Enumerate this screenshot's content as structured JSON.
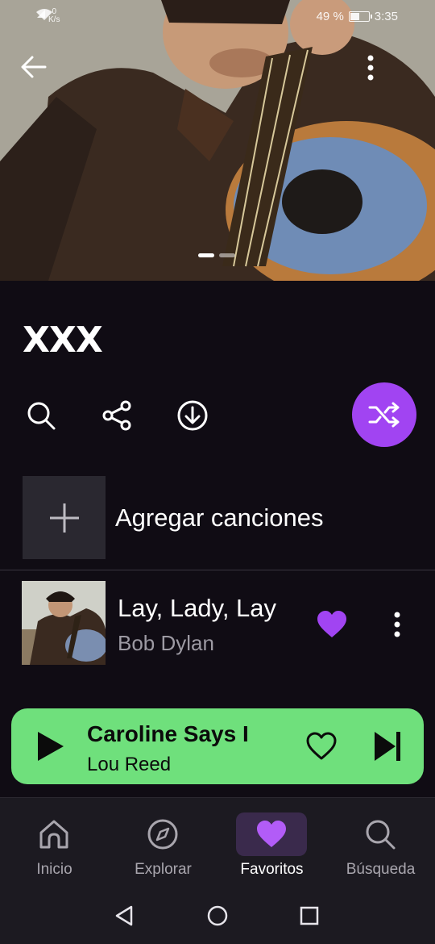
{
  "status_bar": {
    "speed_value": "0",
    "speed_unit": "K/s",
    "battery": "49 %",
    "time": "3:35"
  },
  "playlist": {
    "title": "XXX"
  },
  "add_songs": {
    "label": "Agregar canciones"
  },
  "songs": [
    {
      "title": "Lay, Lady, Lay",
      "artist": "Bob Dylan",
      "favorite": true
    }
  ],
  "now_playing": {
    "title": "Caroline Says I",
    "artist": "Lou Reed"
  },
  "bottom_nav": {
    "items": [
      {
        "label": "Inicio",
        "icon": "home-icon"
      },
      {
        "label": "Explorar",
        "icon": "compass-icon"
      },
      {
        "label": "Favoritos",
        "icon": "heart-icon"
      },
      {
        "label": "Búsqueda",
        "icon": "search-icon"
      }
    ],
    "active": "Favoritos"
  },
  "colors": {
    "background": "#100c14",
    "accent_purple": "#a144f2",
    "player_green": "#6fe07c",
    "nav_background": "#1c1a21"
  }
}
